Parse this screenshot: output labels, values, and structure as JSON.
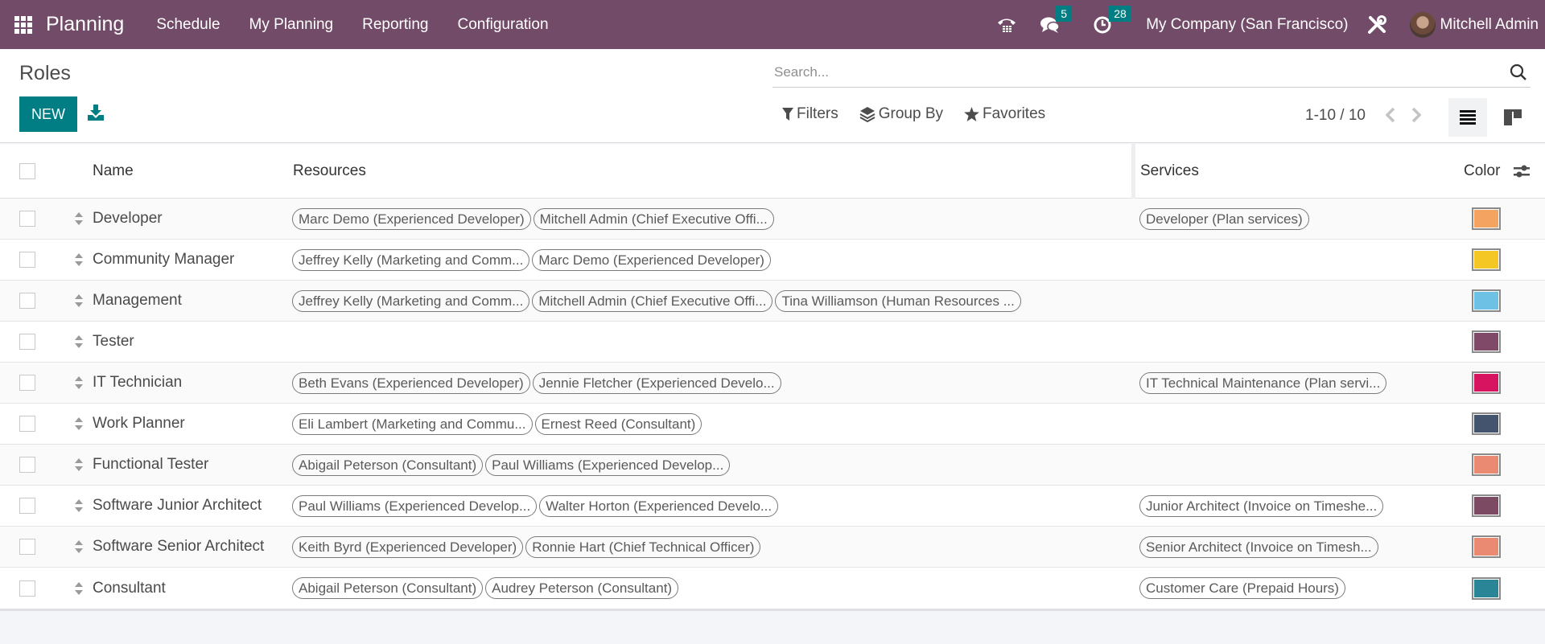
{
  "navbar": {
    "app_name": "Planning",
    "menu": [
      "Schedule",
      "My Planning",
      "Reporting",
      "Configuration"
    ],
    "messages_badge": "5",
    "activities_badge": "28",
    "company": "My Company (San Francisco)",
    "user": "Mitchell Admin",
    "icons": [
      "apps-grid-icon",
      "phone-icon",
      "chat-icon",
      "clock-icon",
      "tools-icon"
    ],
    "color": "#714b67"
  },
  "control_panel": {
    "title": "Roles",
    "new_label": "NEW",
    "search_placeholder": "Search...",
    "filters_label": "Filters",
    "group_by_label": "Group By",
    "favorites_label": "Favorites",
    "pager": "1-10 / 10",
    "accent": "#017e84"
  },
  "table": {
    "columns": {
      "name": "Name",
      "resources": "Resources",
      "services": "Services",
      "color": "Color"
    },
    "rows": [
      {
        "name": "Developer",
        "resources": [
          "Marc Demo (Experienced Developer)",
          "Mitchell Admin (Chief Executive Offi..."
        ],
        "services": [
          "Developer (Plan services)"
        ],
        "color": "#f4a460"
      },
      {
        "name": "Community Manager",
        "resources": [
          "Jeffrey Kelly (Marketing and Comm...",
          "Marc Demo (Experienced Developer)"
        ],
        "services": [],
        "color": "#f4c724"
      },
      {
        "name": "Management",
        "resources": [
          "Jeffrey Kelly (Marketing and Comm...",
          "Mitchell Admin (Chief Executive Offi...",
          "Tina Williamson (Human Resources ..."
        ],
        "services": [],
        "color": "#6cc1e5"
      },
      {
        "name": "Tester",
        "resources": [],
        "services": [],
        "color": "#814968"
      },
      {
        "name": "IT Technician",
        "resources": [
          "Beth Evans (Experienced Developer)",
          "Jennie Fletcher (Experienced Develo..."
        ],
        "services": [
          "IT Technical Maintenance (Plan servi..."
        ],
        "color": "#d6145f"
      },
      {
        "name": "Work Planner",
        "resources": [
          "Eli Lambert (Marketing and Commu...",
          "Ernest Reed (Consultant)"
        ],
        "services": [],
        "color": "#44546e"
      },
      {
        "name": "Functional Tester",
        "resources": [
          "Abigail Peterson (Consultant)",
          "Paul Williams (Experienced Develop..."
        ],
        "services": [],
        "color": "#ea8a73"
      },
      {
        "name": "Software Junior Architect",
        "resources": [
          "Paul Williams (Experienced Develop...",
          "Walter Horton (Experienced Develo..."
        ],
        "services": [
          "Junior Architect (Invoice on Timeshe..."
        ],
        "color": "#7d4a64"
      },
      {
        "name": "Software Senior Architect",
        "resources": [
          "Keith Byrd (Experienced Developer)",
          "Ronnie Hart (Chief Technical Officer)"
        ],
        "services": [
          "Senior Architect (Invoice on Timesh..."
        ],
        "color": "#ea8a73"
      },
      {
        "name": "Consultant",
        "resources": [
          "Abigail Peterson (Consultant)",
          "Audrey Peterson (Consultant)"
        ],
        "services": [
          "Customer Care (Prepaid Hours)"
        ],
        "color": "#2a8597"
      }
    ]
  }
}
